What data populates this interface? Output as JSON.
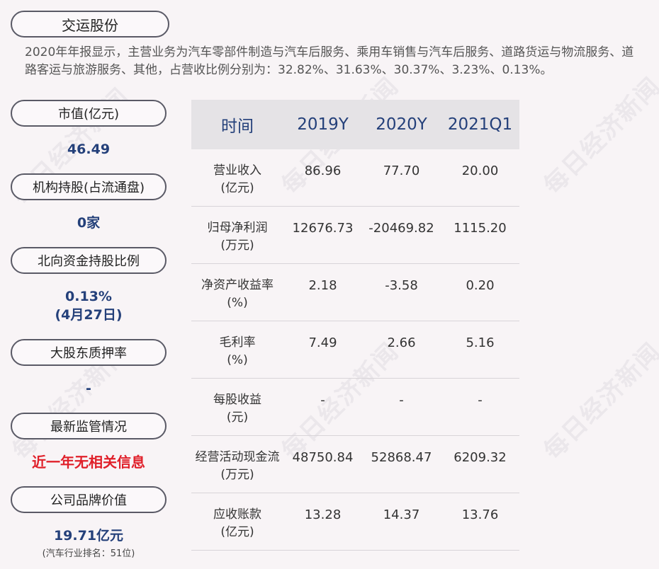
{
  "title": "交运股份",
  "intro": "2020年年报显示，主营业务为汽车零部件制造与汽车后服务、乘用车销售与汽车后服务、道路货运与物流服务、道路客运与旅游服务、其他，占营收比例分别为：32.82%、31.63%、30.37%、3.23%、0.13%。",
  "side": {
    "market_cap_label": "市值(亿元)",
    "market_cap_value": "46.49",
    "institution_label": "机构持股(占流通盘)",
    "institution_value": "0家",
    "northbound_label": "北向资金持股比例",
    "northbound_value": "0.13%",
    "northbound_date": "(4月27日)",
    "pledge_label": "大股东质押率",
    "pledge_value": "-",
    "regulation_label": "最新监管情况",
    "regulation_value": "近一年无相关信息",
    "brand_label": "公司品牌价值",
    "brand_value": "19.71亿元",
    "brand_rank": "(汽车行业排名：51位)"
  },
  "table": {
    "headers": [
      "时间",
      "2019Y",
      "2020Y",
      "2021Q1"
    ],
    "rows": [
      {
        "l1": "营业收入",
        "l2": "(亿元)",
        "v": [
          "86.96",
          "77.70",
          "20.00"
        ]
      },
      {
        "l1": "归母净利润",
        "l2": "(万元)",
        "v": [
          "12676.73",
          "-20469.82",
          "1115.20"
        ]
      },
      {
        "l1": "净资产收益率",
        "l2": "(%)",
        "v": [
          "2.18",
          "-3.58",
          "0.20"
        ]
      },
      {
        "l1": "毛利率",
        "l2": "(%)",
        "v": [
          "7.49",
          "2.66",
          "5.16"
        ]
      },
      {
        "l1": "每股收益",
        "l2": "(元)",
        "v": [
          "-",
          "-",
          "-"
        ]
      },
      {
        "l1": "经营活动现金流",
        "l2": "(万元)",
        "v": [
          "48750.84",
          "52868.47",
          "6209.32"
        ]
      },
      {
        "l1": "应收账款",
        "l2": "(亿元)",
        "v": [
          "13.28",
          "14.37",
          "13.76"
        ]
      }
    ]
  },
  "watermark": "每日经济新闻"
}
